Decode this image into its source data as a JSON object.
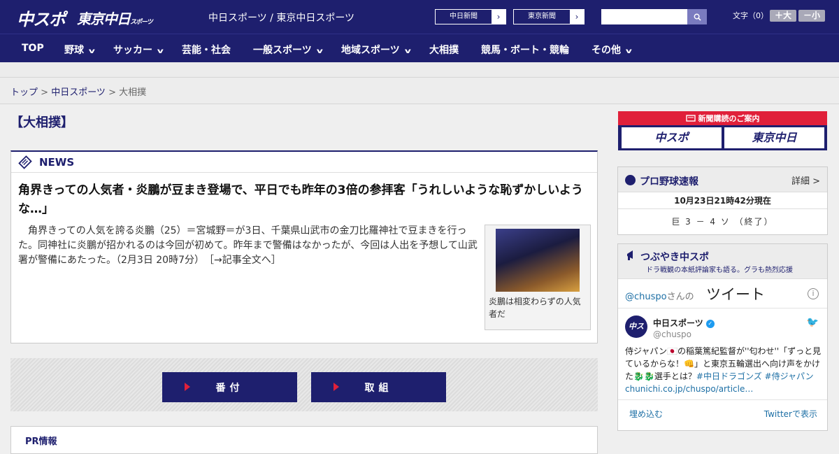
{
  "header": {
    "logo_chuspo": "中スポ",
    "logo_tokyo": "東京中日",
    "logo_tokyo_small": "スポーツ",
    "site_title": "中日スポーツ / 東京中日スポーツ",
    "paper1": "中日新聞",
    "paper2": "東京新聞",
    "search_placeholder": "",
    "fontsize_label": "文字（0）",
    "font_larger": "＋大",
    "font_smaller": "－小"
  },
  "nav": {
    "items": [
      "TOP",
      "野球",
      "サッカー",
      "芸能・社会",
      "一般スポーツ",
      "地域スポーツ",
      "大相撲",
      "競馬・ボート・競輪",
      "その他"
    ]
  },
  "breadcrumb": {
    "top": "トップ",
    "sep": " > ",
    "section": "中日スポーツ",
    "current": "大相撲"
  },
  "main": {
    "section_title": "【大相撲】",
    "news_label": "NEWS",
    "headline": "角界きっての人気者・炎鵬が豆まき登場で、平日でも昨年の3倍の参拝客「うれしいような恥ずかしいような…」",
    "body": "　角界きっての人気を誇る炎鵬（25）＝宮城野＝が3日、千葉県山武市の金刀比羅神社で豆まきを行った。同神社に炎鵬が招かれるのは今回が初めて。昨年まで警備はなかったが、今回は人出を予想して山武署が警備にあたった。（2月3日 20時7分）　［→記事全文へ］",
    "photo_caption": "炎鵬は相変わらずの人気者だ",
    "button_banzuke": "番付",
    "button_torikumi": "取組",
    "pr_label": "PR情報"
  },
  "sidebar": {
    "ad_top": "新聞購読のご案内",
    "ad_left": "中スポ",
    "ad_right": "東京中日",
    "baseball_title": "プロ野球速報",
    "baseball_more": "詳細 >",
    "baseball_time": "10月23日21時42分現在",
    "baseball_score": "巨 3 － 4 ソ （終了）",
    "tw_title": "つぶやき中スポ",
    "tw_sub": "ドラ戦観の本紙評論家も語る。グラも熱烈応援",
    "tw_handle": "@chuspo",
    "tw_handle_suffix": "さんの",
    "tw_tweets": "ツイート",
    "tw_name": "中日スポーツ",
    "tw_user": "@chuspo",
    "tw_text": "侍ジャパン🇯🇵の稲葉篤紀監督が''匂わせ''「ずっと見ているからな！👊」と東京五輪選出へ向け声をかけた🐉🐉選手とは？",
    "tw_tags": "#中日ドラゴンズ #侍ジャパン",
    "tw_link": "chunichi.co.jp/chuspo/article…",
    "tw_embed": "埋め込む",
    "tw_view": "Twitterで表示"
  }
}
